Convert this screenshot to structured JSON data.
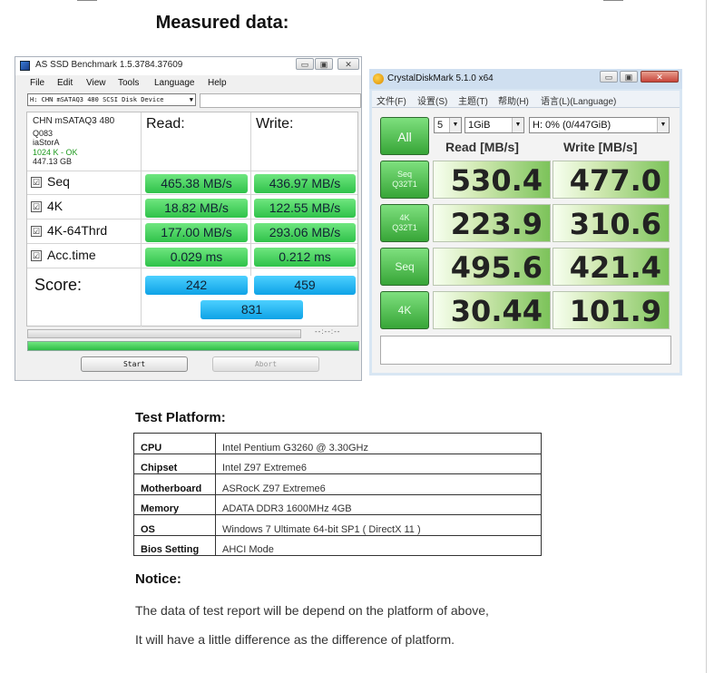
{
  "heading": "Measured data:",
  "as_ssd": {
    "title": "AS SSD Benchmark 1.5.3784.37609",
    "window_buttons": [
      "▭",
      "▣",
      "✕"
    ],
    "menu": [
      "File",
      "Edit",
      "View",
      "Tools",
      "Language",
      "Help"
    ],
    "drive": "H: CHN mSATAQ3 480 SCSI Disk Device",
    "dropdown_glyph": "▼",
    "info": [
      "CHN mSATAQ3 480",
      "Q083",
      "iaStorA",
      "1024 K - OK",
      "447.13 GB"
    ],
    "read_header": "Read:",
    "write_header": "Write:",
    "check_glyph": "☑",
    "rows": [
      {
        "label": "Seq",
        "read": "465.38 MB/s",
        "write": "436.97 MB/s"
      },
      {
        "label": "4K",
        "read": "18.82 MB/s",
        "write": "122.55 MB/s"
      },
      {
        "label": "4K-64Thrd",
        "read": "177.00 MB/s",
        "write": "293.06 MB/s"
      },
      {
        "label": "Acc.time",
        "read": "0.029 ms",
        "write": "0.212 ms"
      }
    ],
    "score_label": "Score:",
    "score_read": "242",
    "score_write": "459",
    "score_total": "831",
    "elapsed": "--:--:--",
    "start_label": "Start",
    "abort_label": "Abort"
  },
  "cdm": {
    "title": "CrystalDiskMark 5.1.0 x64",
    "window_buttons": [
      "▭",
      "▣",
      "✕"
    ],
    "menu": [
      "文件(F)",
      "设置(S)",
      "主题(T)",
      "帮助(H)",
      "语言(L)(Language)"
    ],
    "all_label": "All",
    "count": "5",
    "size": "1GiB",
    "drive": "H: 0% (0/447GiB)",
    "dropdown_glyph": "▼",
    "read_header": "Read [MB/s]",
    "write_header": "Write [MB/s]",
    "rows": [
      {
        "label_line1": "Seq",
        "label_line2": "Q32T1",
        "read": "530.4",
        "write": "477.0"
      },
      {
        "label_line1": "4K",
        "label_line2": "Q32T1",
        "read": "223.9",
        "write": "310.6"
      },
      {
        "label_line1": "Seq",
        "label_line2": "",
        "read": "495.6",
        "write": "421.4"
      },
      {
        "label_line1": "4K",
        "label_line2": "",
        "read": "30.44",
        "write": "101.9"
      }
    ]
  },
  "platform": {
    "title": "Test Platform:",
    "rows": [
      {
        "key": "CPU",
        "value": "Intel Pentium G3260 @ 3.30GHz"
      },
      {
        "key": "Chipset",
        "value": "Intel Z97 Extreme6"
      },
      {
        "key": "Motherboard",
        "value": "ASRocK Z97 Extreme6"
      },
      {
        "key": "Memory",
        "value": "ADATA DDR3 1600MHz 4GB"
      },
      {
        "key": "OS",
        "value": "Windows 7 Ultimate 64-bit SP1 ( DirectX 11 )"
      },
      {
        "key": "Bios Setting",
        "value": "AHCI Mode"
      }
    ]
  },
  "notice": {
    "title": "Notice:",
    "line1": "The data of test report will be depend on the platform of above,",
    "line2": "It will have a little difference as the difference of platform."
  }
}
